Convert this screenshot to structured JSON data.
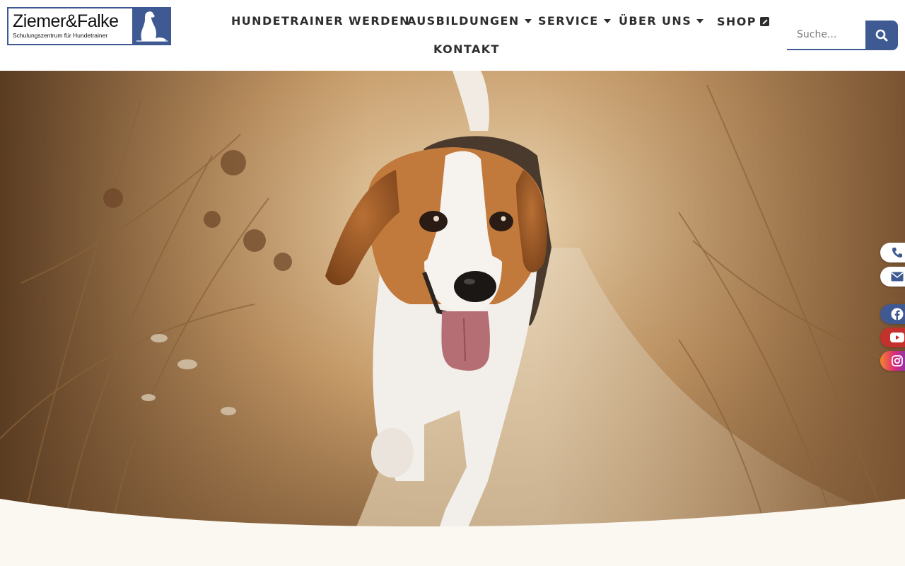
{
  "brand": {
    "name": "Ziemer&Falke",
    "tagline": "Schulungszentrum für Hundetrainer",
    "color": "#3f5a93"
  },
  "nav": {
    "items": [
      {
        "label": "Hundetrainer werden",
        "has_dropdown": false
      },
      {
        "label": "Ausbildungen",
        "has_dropdown": true
      },
      {
        "label": "Service",
        "has_dropdown": true
      },
      {
        "label": "Über uns",
        "has_dropdown": true
      },
      {
        "label": "Shop",
        "external": true
      },
      {
        "label": "Kontakt",
        "has_dropdown": false
      }
    ]
  },
  "search": {
    "placeholder": "Suche...",
    "icon": "search-icon"
  },
  "hero": {
    "image_alt": "Beagle läuft auf einem sandigen Weg zwischen trockenem Gras"
  },
  "side_buttons": [
    {
      "icon": "phone-icon"
    },
    {
      "icon": "envelope-icon"
    },
    {
      "icon": "facebook-icon",
      "color": "#3f5a93"
    },
    {
      "icon": "youtube-icon",
      "color": "#c4302b"
    },
    {
      "icon": "instagram-icon"
    }
  ]
}
